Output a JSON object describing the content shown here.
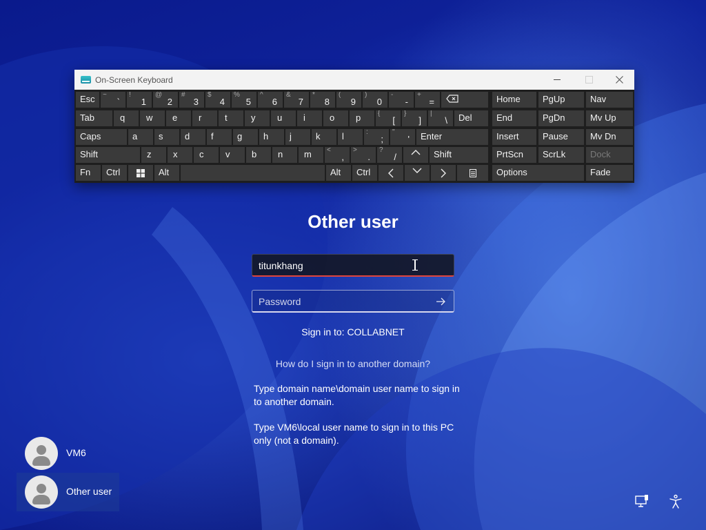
{
  "osk": {
    "title": "On-Screen Keyboard",
    "keys": {
      "esc": "Esc",
      "n1": {
        "main": "1",
        "shift": "!"
      },
      "n2": {
        "main": "2",
        "shift": "@"
      },
      "n3": {
        "main": "3",
        "shift": "#"
      },
      "n4": {
        "main": "4",
        "shift": "$"
      },
      "n5": {
        "main": "5",
        "shift": "%"
      },
      "n6": {
        "main": "6",
        "shift": "^"
      },
      "n7": {
        "main": "7",
        "shift": "&"
      },
      "n8": {
        "main": "8",
        "shift": "*"
      },
      "n9": {
        "main": "9",
        "shift": "("
      },
      "n0": {
        "main": "0",
        "shift": ")"
      },
      "minus": {
        "main": "-",
        "shift": "-"
      },
      "equal": {
        "main": "=",
        "shift": "+"
      },
      "tilde": {
        "main": "`",
        "shift": "~"
      },
      "tab": "Tab",
      "q": "q",
      "w": "w",
      "e": "e",
      "r": "r",
      "t": "t",
      "y": "y",
      "u": "u",
      "i": "i",
      "o": "o",
      "p": "p",
      "lbracket": {
        "main": "[",
        "shift": "{"
      },
      "rbracket": {
        "main": "]",
        "shift": "}"
      },
      "backslash": {
        "main": "\\",
        "shift": "|"
      },
      "del": "Del",
      "caps": "Caps",
      "a": "a",
      "s": "s",
      "d": "d",
      "f": "f",
      "g": "g",
      "h": "h",
      "j": "j",
      "k": "k",
      "l": "l",
      "semicolon": {
        "main": ";",
        "shift": ":"
      },
      "quote": {
        "main": "'",
        "shift": "\""
      },
      "enter": "Enter",
      "shift_l": "Shift",
      "z": "z",
      "x": "x",
      "c": "c",
      "v": "v",
      "b": "b",
      "n": "n",
      "m": "m",
      "comma": {
        "main": ",",
        "shift": "<"
      },
      "period": {
        "main": ".",
        "shift": ">"
      },
      "slash": {
        "main": "/",
        "shift": "?"
      },
      "shift_r": "Shift",
      "fn": "Fn",
      "ctrl_l": "Ctrl",
      "alt_l": "Alt",
      "alt_r": "Alt",
      "ctrl_r": "Ctrl",
      "home": "Home",
      "pgup": "PgUp",
      "nav": "Nav",
      "end": "End",
      "pgdn": "PgDn",
      "mvup": "Mv Up",
      "insert": "Insert",
      "pause": "Pause",
      "mvdn": "Mv Dn",
      "prtscn": "PrtScn",
      "scrlk": "ScrLk",
      "dock": "Dock",
      "options": "Options",
      "fade": "Fade"
    }
  },
  "signin": {
    "title": "Other user",
    "username_value": "titunkhang",
    "password_placeholder": "Password",
    "sign_in_to": "Sign in to: COLLABNET",
    "help_link": "How do I sign in to another domain?",
    "help_text_1": "Type domain name\\domain user name to sign in to another domain.",
    "help_text_2": "Type VM6\\local user name to sign in to this PC only (not a domain)."
  },
  "users": [
    {
      "name": "VM6"
    },
    {
      "name": "Other user"
    }
  ]
}
